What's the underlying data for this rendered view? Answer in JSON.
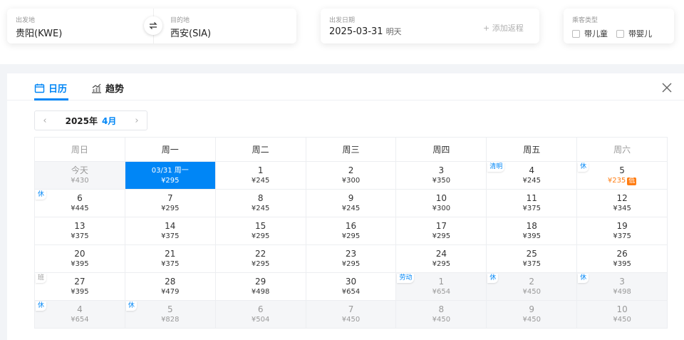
{
  "search": {
    "departure": {
      "label": "出发地",
      "value": "贵阳(KWE)"
    },
    "arrival": {
      "label": "目的地",
      "value": "西安(SIA)"
    },
    "date": {
      "label": "出发日期",
      "value": "2025-03-31",
      "weekday": "明天",
      "add_return": "+ 添加返程"
    },
    "passenger": {
      "label": "乘客类型",
      "child": "带儿童",
      "infant": "带婴儿"
    }
  },
  "calendar": {
    "tabs": {
      "calendar": "日历",
      "trend": "趋势"
    },
    "year": "2025年",
    "month": "4月",
    "weekdays": [
      "周日",
      "周一",
      "周二",
      "周三",
      "周四",
      "周五",
      "周六"
    ],
    "rows": [
      [
        {
          "day": "今天",
          "price": "¥430",
          "muted": true
        },
        {
          "day": "03/31 周一",
          "price": "¥295",
          "selected": true
        },
        {
          "day": "1",
          "price": "¥245"
        },
        {
          "day": "2",
          "price": "¥300"
        },
        {
          "day": "3",
          "price": "¥350"
        },
        {
          "day": "4",
          "price": "¥245",
          "tag": "清明"
        },
        {
          "day": "5",
          "price": "¥235",
          "tag": "休",
          "low": true,
          "low_label": "低"
        }
      ],
      [
        {
          "day": "6",
          "price": "¥445",
          "tag": "休"
        },
        {
          "day": "7",
          "price": "¥295"
        },
        {
          "day": "8",
          "price": "¥245"
        },
        {
          "day": "9",
          "price": "¥245"
        },
        {
          "day": "10",
          "price": "¥300"
        },
        {
          "day": "11",
          "price": "¥375"
        },
        {
          "day": "12",
          "price": "¥345"
        }
      ],
      [
        {
          "day": "13",
          "price": "¥375"
        },
        {
          "day": "14",
          "price": "¥375"
        },
        {
          "day": "15",
          "price": "¥295"
        },
        {
          "day": "16",
          "price": "¥295"
        },
        {
          "day": "17",
          "price": "¥295"
        },
        {
          "day": "18",
          "price": "¥395"
        },
        {
          "day": "19",
          "price": "¥375"
        }
      ],
      [
        {
          "day": "20",
          "price": "¥395"
        },
        {
          "day": "21",
          "price": "¥375"
        },
        {
          "day": "22",
          "price": "¥295"
        },
        {
          "day": "23",
          "price": "¥295"
        },
        {
          "day": "24",
          "price": "¥295"
        },
        {
          "day": "25",
          "price": "¥375"
        },
        {
          "day": "26",
          "price": "¥395"
        }
      ],
      [
        {
          "day": "27",
          "price": "¥395",
          "tag": "班",
          "tag_type": "ban"
        },
        {
          "day": "28",
          "price": "¥479"
        },
        {
          "day": "29",
          "price": "¥498"
        },
        {
          "day": "30",
          "price": "¥654"
        },
        {
          "day": "1",
          "price": "¥654",
          "muted": true,
          "tag": "劳动"
        },
        {
          "day": "2",
          "price": "¥450",
          "muted": true,
          "tag": "休"
        },
        {
          "day": "3",
          "price": "¥498",
          "muted": true,
          "tag": "休"
        }
      ],
      [
        {
          "day": "4",
          "price": "¥654",
          "muted": true,
          "tag": "休"
        },
        {
          "day": "5",
          "price": "¥828",
          "muted": true,
          "tag": "休"
        },
        {
          "day": "6",
          "price": "¥504",
          "muted": true
        },
        {
          "day": "7",
          "price": "¥450",
          "muted": true
        },
        {
          "day": "8",
          "price": "¥450",
          "muted": true
        },
        {
          "day": "9",
          "price": "¥450",
          "muted": true
        },
        {
          "day": "10",
          "price": "¥450",
          "muted": true
        }
      ]
    ]
  },
  "colors": {
    "accent": "#0086f6",
    "low_price": "#ff7d13"
  }
}
